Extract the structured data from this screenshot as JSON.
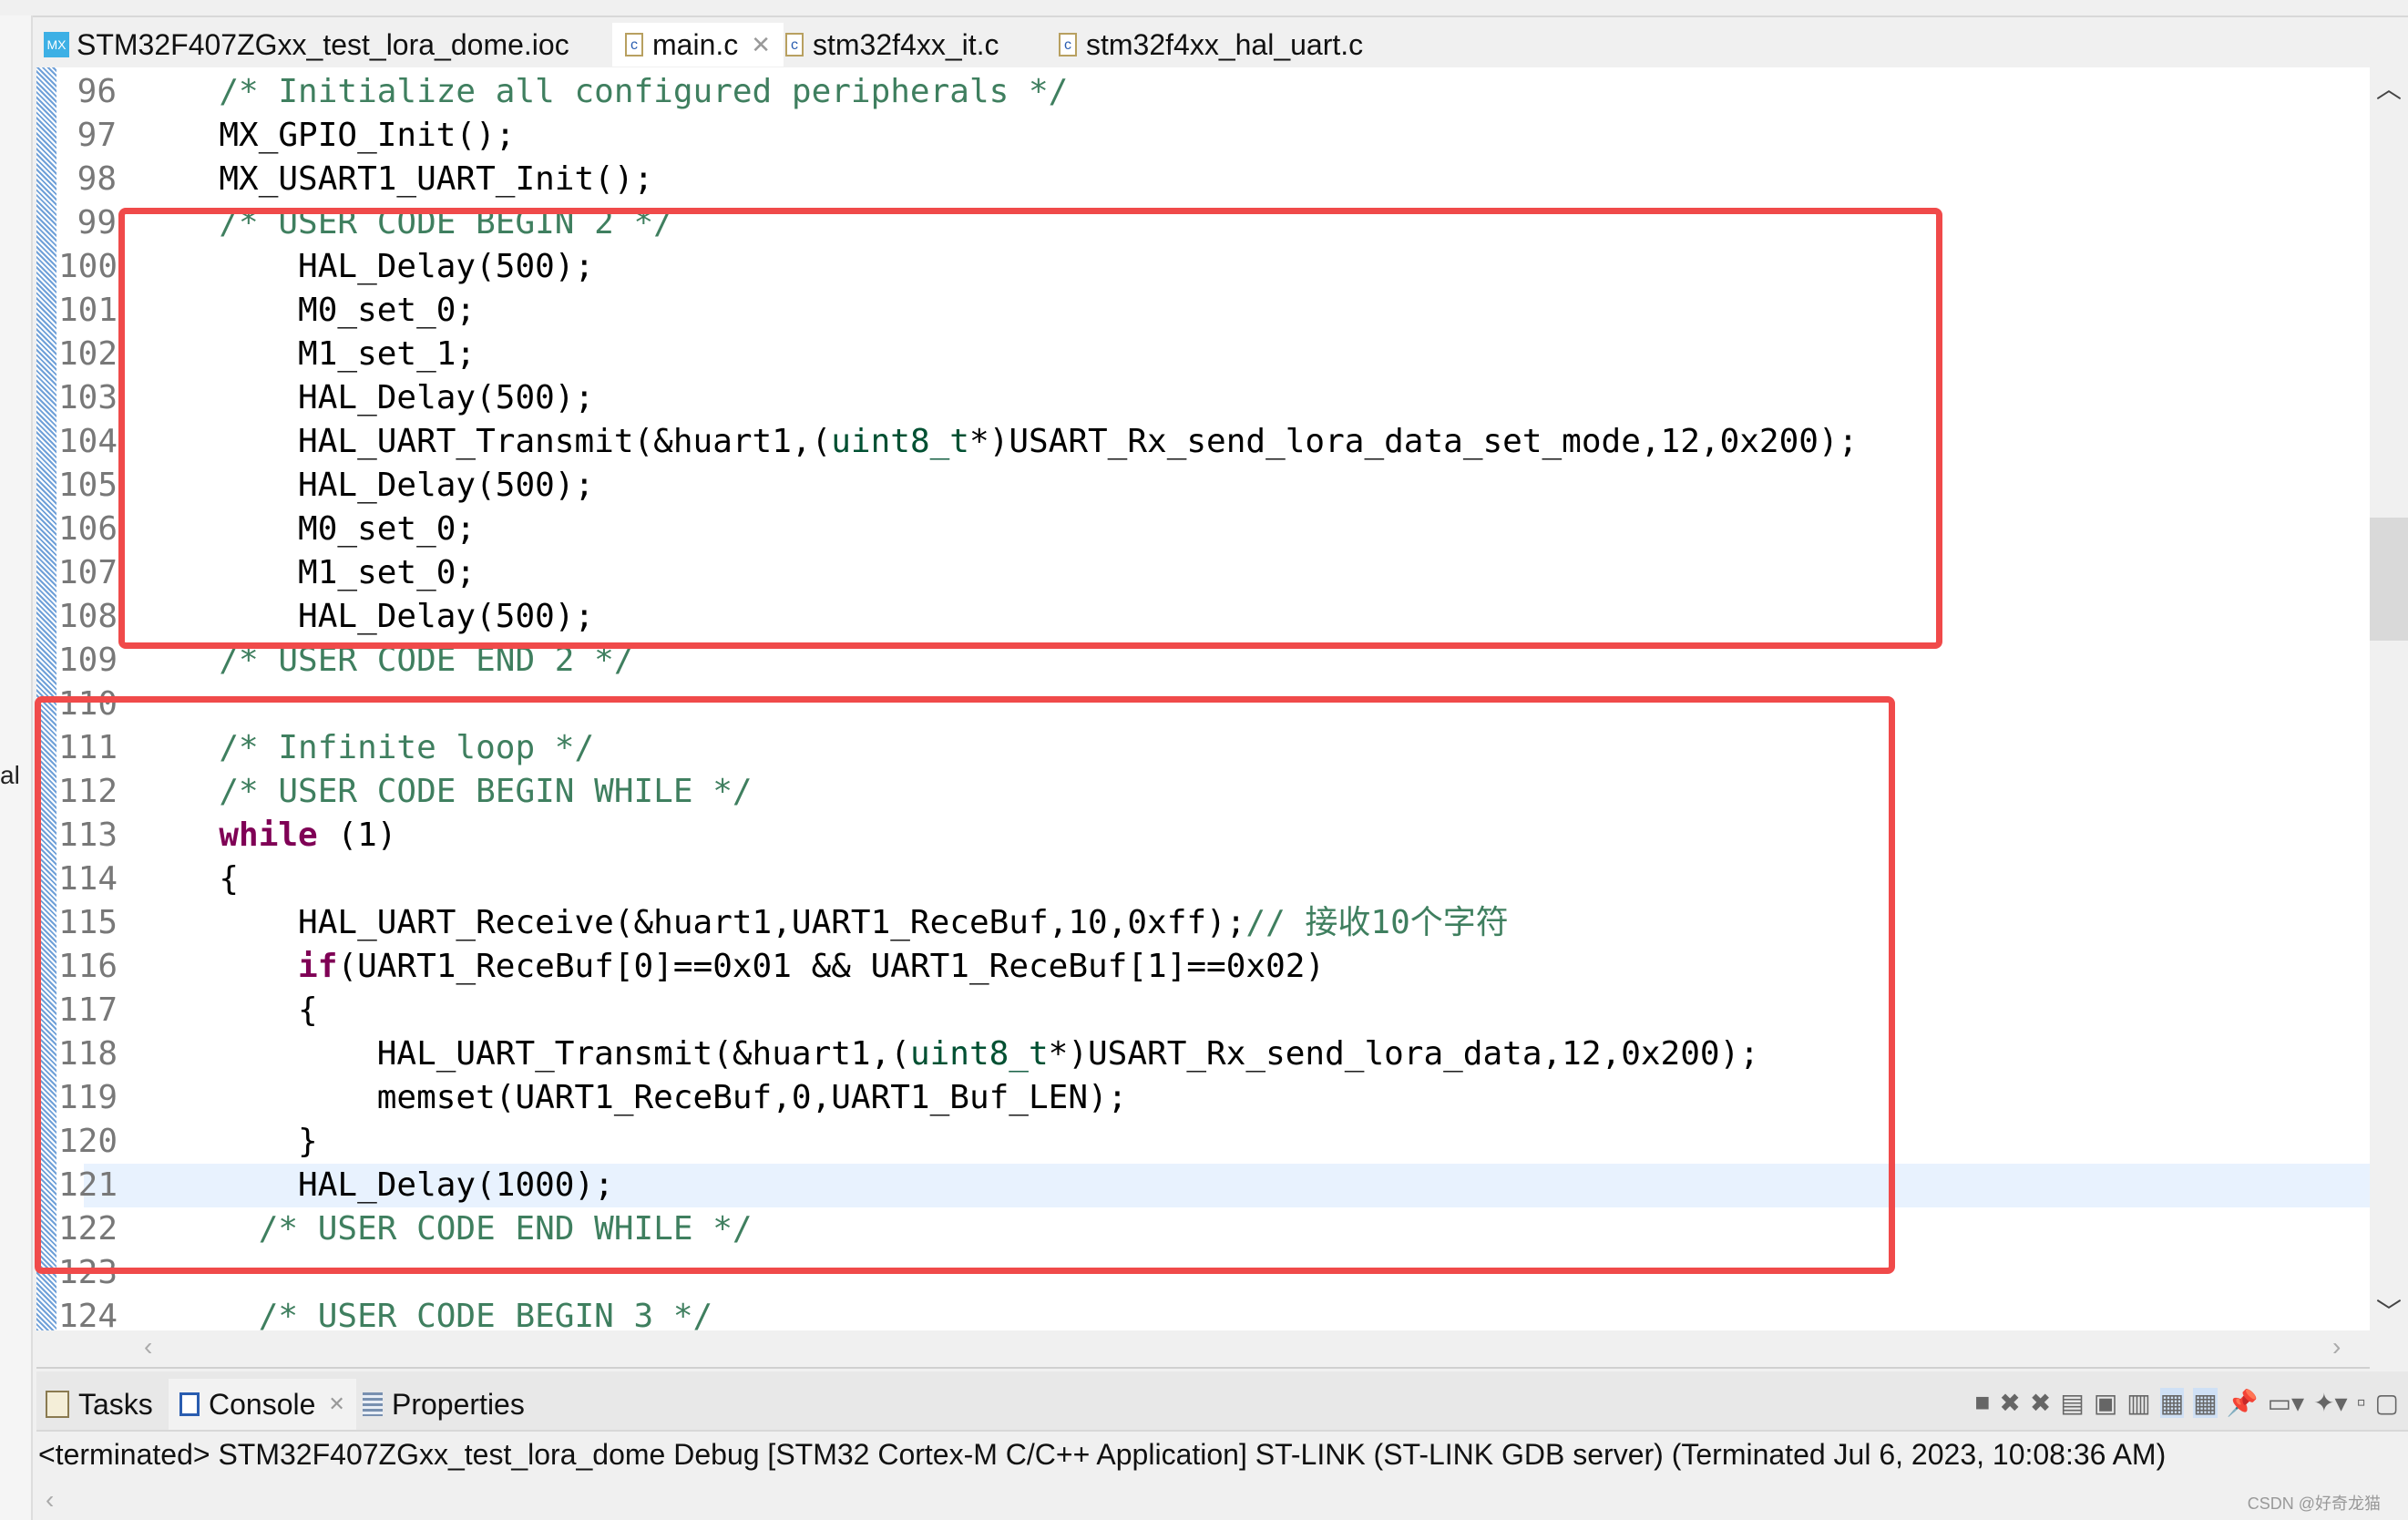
{
  "tabs": [
    {
      "label": "STM32F407ZGxx_test_lora_dome.ioc",
      "icon": "mx-icon",
      "active": false
    },
    {
      "label": "main.c",
      "icon": "c-file-icon",
      "active": true,
      "closable": true
    },
    {
      "label": "stm32f4xx_it.c",
      "icon": "c-file-icon",
      "active": false
    },
    {
      "label": "stm32f4xx_hal_uart.c",
      "icon": "c-file-icon",
      "active": false
    }
  ],
  "left_fragment": "al",
  "editor": {
    "highlighted_line": "121",
    "lines": [
      {
        "num": "96",
        "tokens": [
          {
            "t": "  /* Initialize all configured peripherals */",
            "c": "comment"
          }
        ]
      },
      {
        "num": "97",
        "tokens": [
          {
            "t": "  MX_GPIO_Init();",
            "c": "plain"
          }
        ]
      },
      {
        "num": "98",
        "tokens": [
          {
            "t": "  MX_USART1_UART_Init();",
            "c": "plain"
          }
        ]
      },
      {
        "num": "99",
        "tokens": [
          {
            "t": "  /* USER CODE BEGIN 2 */",
            "c": "comment"
          }
        ]
      },
      {
        "num": "100",
        "tokens": [
          {
            "t": "      HAL_Delay(500);",
            "c": "plain"
          }
        ]
      },
      {
        "num": "101",
        "tokens": [
          {
            "t": "      M0_set_0;",
            "c": "plain"
          }
        ]
      },
      {
        "num": "102",
        "tokens": [
          {
            "t": "      M1_set_1;",
            "c": "plain"
          }
        ]
      },
      {
        "num": "103",
        "tokens": [
          {
            "t": "      HAL_Delay(500);",
            "c": "plain"
          }
        ]
      },
      {
        "num": "104",
        "tokens": [
          {
            "t": "      HAL_UART_Transmit(&huart1,(",
            "c": "plain"
          },
          {
            "t": "uint8_t",
            "c": "type"
          },
          {
            "t": "*)USART_Rx_send_lora_data_set_mode,12,0x200);",
            "c": "plain"
          }
        ]
      },
      {
        "num": "105",
        "tokens": [
          {
            "t": "      HAL_Delay(500);",
            "c": "plain"
          }
        ]
      },
      {
        "num": "106",
        "tokens": [
          {
            "t": "      M0_set_0;",
            "c": "plain"
          }
        ]
      },
      {
        "num": "107",
        "tokens": [
          {
            "t": "      M1_set_0;",
            "c": "plain"
          }
        ]
      },
      {
        "num": "108",
        "tokens": [
          {
            "t": "      HAL_Delay(500);",
            "c": "plain"
          }
        ]
      },
      {
        "num": "109",
        "tokens": [
          {
            "t": "  /* USER CODE END 2 */",
            "c": "comment"
          }
        ]
      },
      {
        "num": "110",
        "tokens": []
      },
      {
        "num": "111",
        "tokens": [
          {
            "t": "  /* Infinite loop */",
            "c": "comment"
          }
        ]
      },
      {
        "num": "112",
        "tokens": [
          {
            "t": "  /* USER CODE BEGIN WHILE */",
            "c": "comment"
          }
        ]
      },
      {
        "num": "113",
        "tokens": [
          {
            "t": "  ",
            "c": "plain"
          },
          {
            "t": "while",
            "c": "keyword"
          },
          {
            "t": " (1)",
            "c": "plain"
          }
        ]
      },
      {
        "num": "114",
        "tokens": [
          {
            "t": "  {",
            "c": "plain"
          }
        ]
      },
      {
        "num": "115",
        "tokens": [
          {
            "t": "      HAL_UART_Receive(&huart1,UART1_ReceBuf,10,0xff);",
            "c": "plain"
          },
          {
            "t": "// 接收10个字符",
            "c": "comment"
          }
        ]
      },
      {
        "num": "116",
        "tokens": [
          {
            "t": "      ",
            "c": "plain"
          },
          {
            "t": "if",
            "c": "keyword"
          },
          {
            "t": "(UART1_ReceBuf[0]==0x01 && UART1_ReceBuf[1]==0x02)",
            "c": "plain"
          }
        ]
      },
      {
        "num": "117",
        "tokens": [
          {
            "t": "      {",
            "c": "plain"
          }
        ]
      },
      {
        "num": "118",
        "tokens": [
          {
            "t": "          HAL_UART_Transmit(&huart1,(",
            "c": "plain"
          },
          {
            "t": "uint8_t",
            "c": "type"
          },
          {
            "t": "*)USART_Rx_send_lora_data,12,0x200);",
            "c": "plain"
          }
        ]
      },
      {
        "num": "119",
        "tokens": [
          {
            "t": "          memset(UART1_ReceBuf,0,UART1_Buf_LEN);",
            "c": "plain"
          }
        ]
      },
      {
        "num": "120",
        "tokens": [
          {
            "t": "      }",
            "c": "plain"
          }
        ]
      },
      {
        "num": "121",
        "tokens": [
          {
            "t": "      HAL_Delay(1000);",
            "c": "plain"
          }
        ]
      },
      {
        "num": "122",
        "tokens": [
          {
            "t": "    /* USER CODE END WHILE */",
            "c": "comment"
          }
        ]
      },
      {
        "num": "123",
        "tokens": []
      },
      {
        "num": "124",
        "tokens": [
          {
            "t": "    /* USER CODE BEGIN 3 */",
            "c": "comment"
          }
        ]
      }
    ]
  },
  "colors": {
    "comment": "#3f7f5f",
    "keyword": "#7f0055",
    "type": "#005032",
    "annotation_box": "#f04a4a",
    "current_line": "#e8f2fe"
  },
  "panel": {
    "tabs": [
      {
        "label": "Tasks",
        "icon": "tasks-icon"
      },
      {
        "label": "Console",
        "icon": "console-icon",
        "active": true,
        "closable": true
      },
      {
        "label": "Properties",
        "icon": "properties-icon"
      }
    ],
    "console_text": "<terminated> STM32F407ZGxx_test_lora_dome Debug [STM32 Cortex-M C/C++ Application] ST-LINK (ST-LINK GDB server) (Terminated Jul 6, 2023, 10:08:36 AM)"
  },
  "watermark": "CSDN @好奇龙猫"
}
